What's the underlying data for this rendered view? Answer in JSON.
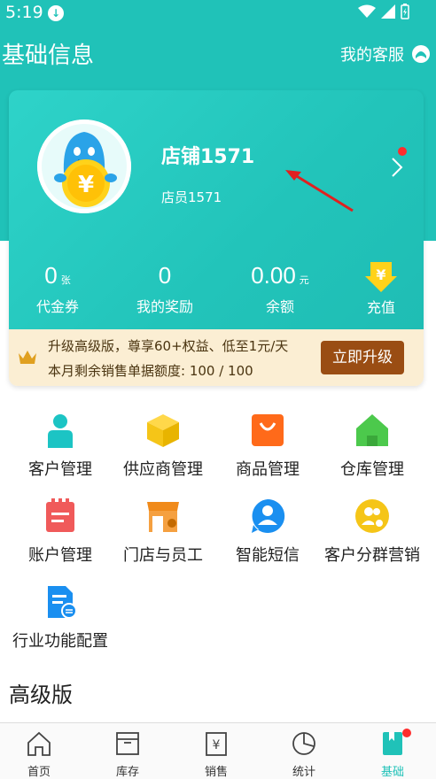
{
  "status_bar": {
    "time": "5:19"
  },
  "header": {
    "title": "基础信息",
    "service_label": "我的客服"
  },
  "store": {
    "name": "店铺1571",
    "staff": "店员1571"
  },
  "stats": [
    {
      "value": "0",
      "unit": "张",
      "label": "代金券"
    },
    {
      "value": "0",
      "unit": "",
      "label": "我的奖励"
    },
    {
      "value": "0.00",
      "unit": "元",
      "label": "余额"
    }
  ],
  "recharge_label": "充值",
  "upgrade": {
    "line1": "升级高级版，尊享60+权益、低至1元/天",
    "line2": "本月剩余销售单据额度: 100 / 100",
    "button": "立即升级"
  },
  "features": [
    {
      "label": "客户管理",
      "icon": "customer-icon",
      "color": "#1cc4c4"
    },
    {
      "label": "供应商管理",
      "icon": "supplier-box-icon",
      "color": "#f5c518"
    },
    {
      "label": "商品管理",
      "icon": "product-bag-icon",
      "color": "#ff6a1a"
    },
    {
      "label": "仓库管理",
      "icon": "warehouse-icon",
      "color": "#4cc94c"
    },
    {
      "label": "账户管理",
      "icon": "account-notepad-icon",
      "color": "#f05a5a"
    },
    {
      "label": "门店与员工",
      "icon": "store-staff-icon",
      "color": "#f08a1a"
    },
    {
      "label": "智能短信",
      "icon": "sms-person-icon",
      "color": "#1a8ff0"
    },
    {
      "label": "客户分群营销",
      "icon": "group-marketing-icon",
      "color": "#f5c518"
    },
    {
      "label": "行业功能配置",
      "icon": "industry-config-icon",
      "color": "#1a8ff0"
    }
  ],
  "section_title": "高级版",
  "tabs": [
    {
      "label": "首页",
      "icon": "home-icon"
    },
    {
      "label": "库存",
      "icon": "inventory-icon"
    },
    {
      "label": "销售",
      "icon": "sales-icon"
    },
    {
      "label": "统计",
      "icon": "stats-icon"
    },
    {
      "label": "基础",
      "icon": "basic-book-icon",
      "active": true
    }
  ],
  "colors": {
    "primary": "#20c2b8",
    "upgrade_bg": "#fbeed3",
    "upgrade_btn": "#9a4d13",
    "badge": "#ff2d2d"
  }
}
